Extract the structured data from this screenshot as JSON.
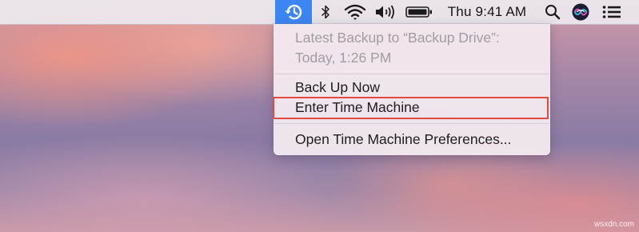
{
  "menubar": {
    "time_machine_icon": "time-machine-icon",
    "clock": "Thu 9:41 AM",
    "icons": [
      "bluetooth-icon",
      "wifi-icon",
      "volume-icon",
      "battery-icon",
      "spotlight-search-icon",
      "siri-icon",
      "notification-center-icon"
    ]
  },
  "menu": {
    "status_line1": "Latest Backup to “Backup Drive”:",
    "status_line2": "Today, 1:26 PM",
    "items": [
      {
        "label": "Back Up Now"
      },
      {
        "label": "Enter Time Machine"
      },
      {
        "label": "Open Time Machine Preferences..."
      }
    ]
  },
  "annotation": {
    "highlight_color": "#e34a3f",
    "highlighted_item": "Enter Time Machine"
  },
  "colors": {
    "menubar_selected": "#3c86f4"
  },
  "watermark": "wsxdn.com"
}
